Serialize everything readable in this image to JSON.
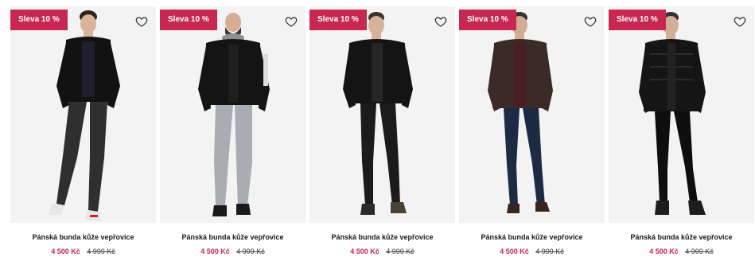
{
  "products": [
    {
      "badge": "Sleva 10 %",
      "title": "Pánská bunda kůže vepřovice",
      "price": "4 500 Kč",
      "old_price": "4 999 Kč",
      "variant": "black-hood-jeans"
    },
    {
      "badge": "Sleva 10 %",
      "title": "Pánská bunda kůže vepřovice",
      "price": "4 500 Kč",
      "old_price": "4 999 Kč",
      "variant": "grey-hood-lightjeans"
    },
    {
      "badge": "Sleva 10 %",
      "title": "Pánská bunda kůže vepřovice",
      "price": "4 500 Kč",
      "old_price": "4 999 Kč",
      "variant": "black-classic"
    },
    {
      "badge": "Sleva 10 %",
      "title": "Pánská bunda kůže vepřovice",
      "price": "4 500 Kč",
      "old_price": "4 999 Kč",
      "variant": "brown-bluejeans"
    },
    {
      "badge": "Sleva 10 %",
      "title": "Pánská bunda kůže vepřovice",
      "price": "4 500 Kč",
      "old_price": "4 999 Kč",
      "variant": "black-quilted"
    }
  ],
  "icons": {
    "wishlist": "heart-outline-icon"
  },
  "colors": {
    "badge": "#c8284f",
    "price": "#c8284f",
    "image_bg": "#f3f3f3"
  }
}
